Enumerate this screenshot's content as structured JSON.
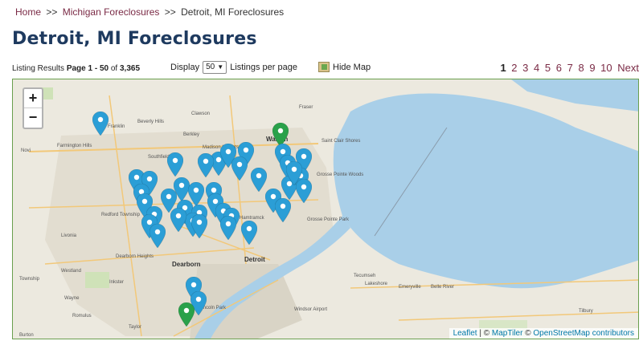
{
  "breadcrumb": {
    "home": "Home",
    "sep1": ">>",
    "michigan": "Michigan Foreclosures",
    "sep2": ">>",
    "current": "Detroit, MI Foreclosures"
  },
  "title": "Detroit, MI Foreclosures",
  "results": {
    "prefix": "Listing Results",
    "page_label": "Page 1 - 50",
    "of": "of",
    "total": "3,365"
  },
  "display": {
    "label": "Display",
    "value": "50",
    "suffix": "Listings per page"
  },
  "hide_map": "Hide Map",
  "pagination": {
    "pages": [
      "1",
      "2",
      "3",
      "4",
      "5",
      "6",
      "7",
      "8",
      "9",
      "10"
    ],
    "next": "Next",
    "current": "1"
  },
  "map": {
    "zoom_in": "+",
    "zoom_out": "−",
    "attribution": {
      "leaflet": "Leaflet",
      "sep": " | © ",
      "maptiler": "MapTiler",
      "sep2": " © ",
      "osm": "OpenStreetMap contributors"
    },
    "labels": {
      "fraser": "Fraser",
      "franklin": "Franklin",
      "beverly_hills": "Beverly Hills",
      "clawson": "Clawson",
      "berkley": "Berkley",
      "farmington_hills": "Farmington Hills",
      "novi": "Novi",
      "southfield": "Southfield",
      "madison_heights": "Madison Heights",
      "warren": "Warren",
      "saint_clair_shores": "Saint Clair Shores",
      "grosse_pointe_woods": "Grosse Pointe Woods",
      "grosse_pointe_park": "Grosse Pointe Park",
      "redford": "Redford Township",
      "livonia": "Livonia",
      "hamtramck": "Hamtramck",
      "dearborn_heights": "Dearborn Heights",
      "dearborn": "Dearborn",
      "detroit": "Detroit",
      "westland": "Westland",
      "inkster": "Inkster",
      "wayne": "Wayne",
      "romulus": "Romulus",
      "taylor": "Taylor",
      "tecumseh": "Tecumseh",
      "lakeshore": "Lakeshore",
      "windsor_airport": "Windsor Airport",
      "emeryville": "Emeryville",
      "belle_river": "Belle River",
      "tilbury": "Tilbury",
      "canton": "Township",
      "burton": "Burton",
      "lincoln_park": "Lincoln Park"
    },
    "colors": {
      "blue_marker": "#2b9ed6",
      "green_marker": "#2aa14a",
      "water": "#a9cfe8",
      "frame": "#6a9f4e"
    }
  }
}
